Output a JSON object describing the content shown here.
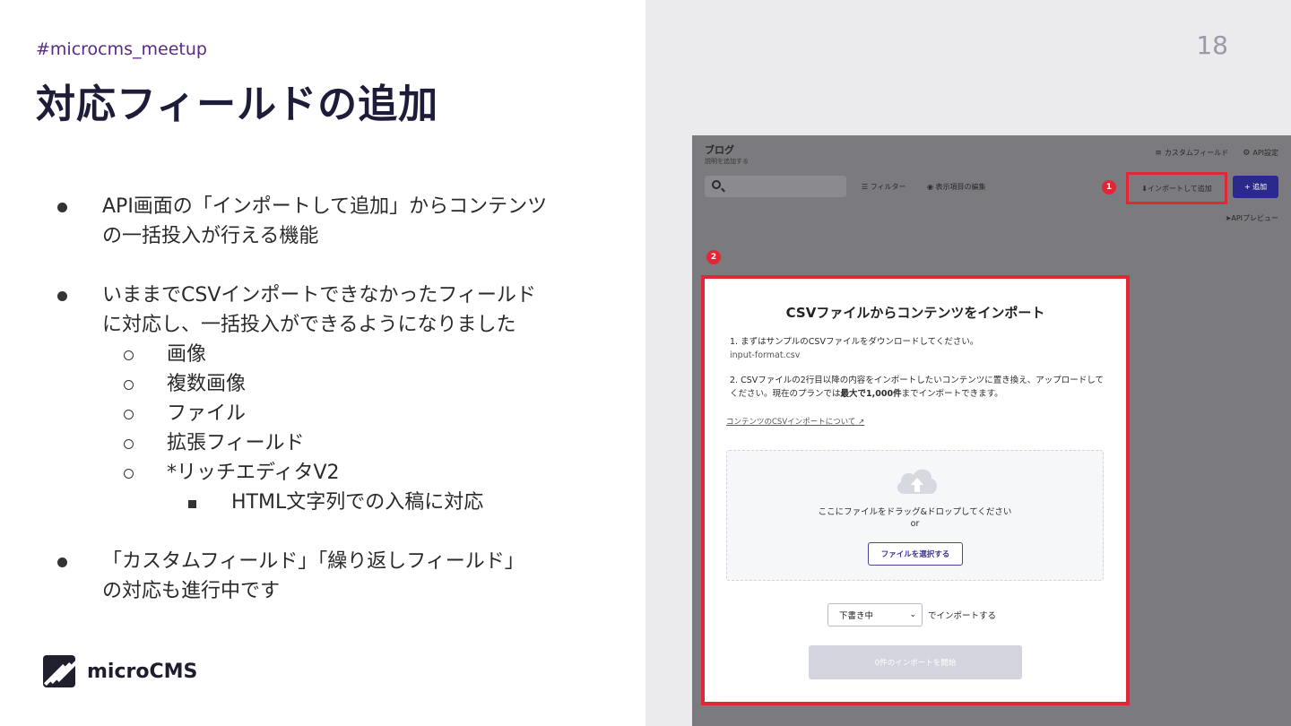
{
  "slide": {
    "hashtag": "#microcms_meetup",
    "title": "対応フィールドの追加",
    "page_number": "18",
    "bullets": [
      {
        "line1": "API画面の「インポートして追加」からコンテンツ",
        "line2": "の一括投入が行える機能"
      },
      {
        "line1": "いままでCSVインポートできなかったフィールド",
        "line2": "に対応し、一括投入ができるようになりました"
      },
      {
        "line1": "「カスタムフィールド」「繰り返しフィールド」",
        "line2": "の対応も進行中です"
      }
    ],
    "subitems": [
      "画像",
      "複数画像",
      "ファイル",
      "拡張フィールド",
      "*リッチエディタV2"
    ],
    "subsubitem": "HTML文字列での入稿に対応",
    "logo_text": "microCMS"
  },
  "screenshot": {
    "api_title": "ブログ",
    "api_subtitle": "説明を追加する",
    "custom_field": "カスタムフィールド",
    "api_settings": "API設定",
    "filter": "フィルター",
    "edit_columns": "表示項目の編集",
    "import_add": "インポートして追加",
    "add": "+ 追加",
    "api_preview": "APIプレビュー",
    "badge1": "1",
    "badge2": "2",
    "modal": {
      "title": "CSVファイルからコンテンツをインポート",
      "step1": "1. まずはサンプルのCSVファイルをダウンロードしてください。",
      "step1_link": "input-format.csv",
      "step2_a": "2. CSVファイルの2行目以降の内容をインポートしたいコンテンツに置き換え、アップロードしてください。現在のプランでは",
      "step2_bold": "最大で1,000件",
      "step2_b": "までインポートできます。",
      "help_link": "コンテンツのCSVインポートについて",
      "drop_text": "ここにファイルをドラッグ&ドロップしてください",
      "drop_or": "or",
      "choose_file": "ファイルを選択する",
      "status_select": "下書き中",
      "status_suffix": "でインポートする",
      "start_button": "0件のインポートを開始"
    }
  },
  "colors": {
    "accent_red": "#e32636",
    "brand_indigo": "#2b2a8c",
    "hashtag_purple": "#5b2a86"
  }
}
